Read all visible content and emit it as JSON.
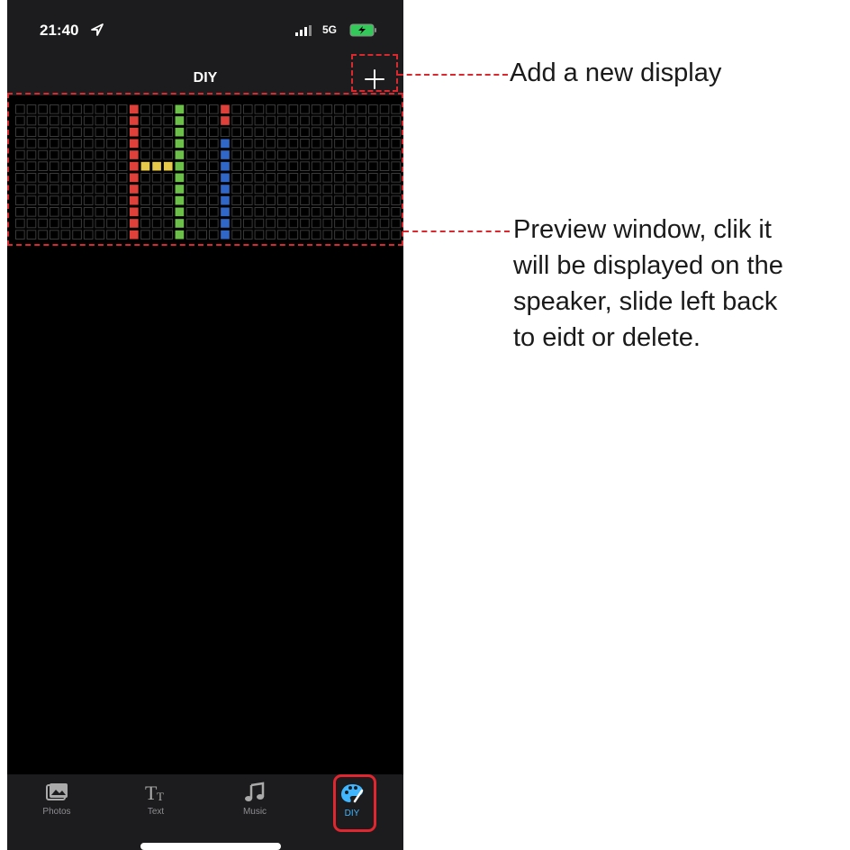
{
  "status_bar": {
    "time": "21:40",
    "network": "5G"
  },
  "nav": {
    "title": "DIY"
  },
  "preview": {
    "grid_cols": 34,
    "grid_rows": 12,
    "pixel_colors": {
      "off": "#3a3a3a",
      "red": "#e0403a",
      "green": "#6cc04a",
      "yellow": "#e6c84a",
      "blue": "#2f66c8"
    }
  },
  "tabs": [
    {
      "label": "Photos",
      "icon": "photos-icon"
    },
    {
      "label": "Text",
      "icon": "text-icon"
    },
    {
      "label": "Music",
      "icon": "music-icon"
    },
    {
      "label": "DIY",
      "icon": "palette-icon",
      "active": true
    }
  ],
  "annotations": {
    "add": "Add a new display",
    "preview_line1": "Preview window,  clik it",
    "preview_line2": "will be displayed on the",
    "preview_line3": "speaker, slide left back",
    "preview_line4": "to eidt or delete."
  },
  "colors": {
    "accent": "#3fb6ff",
    "annotation": "#d9292e"
  }
}
